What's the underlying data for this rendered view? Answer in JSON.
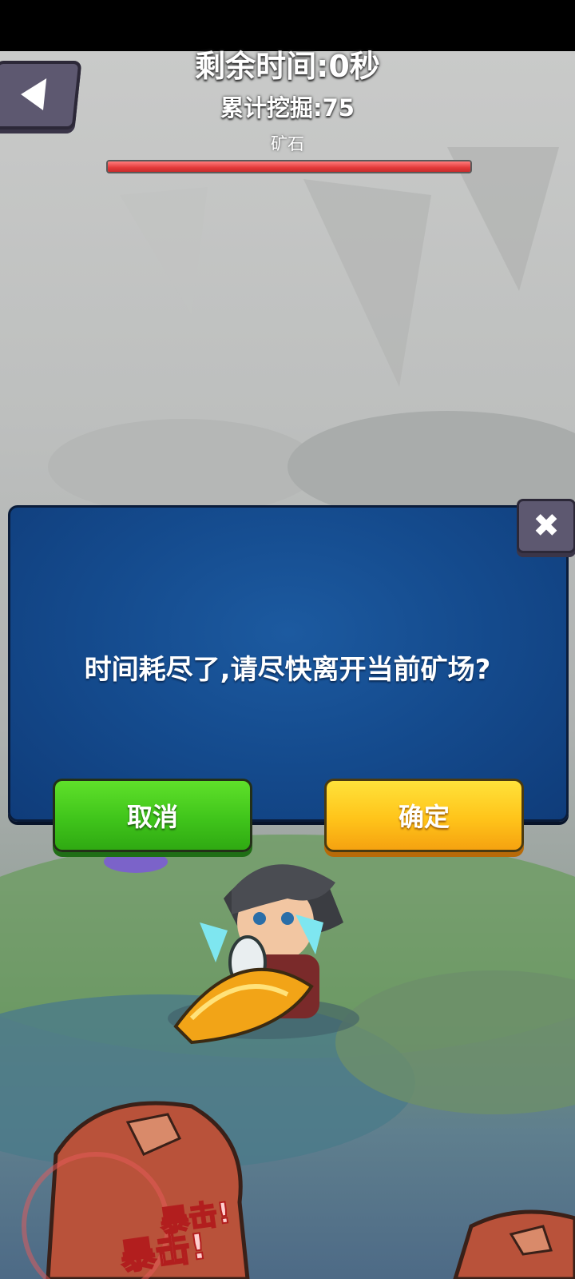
{
  "hud": {
    "timer_text": "剩余时间:0秒",
    "mined_text": "累计挖掘:75",
    "ore_label": "矿石",
    "ore_hp_fraction": 1.0
  },
  "dialog": {
    "message": "时间耗尽了,请尽快离开当前矿场?",
    "cancel_label": "取消",
    "confirm_label": "确定"
  },
  "icons": {
    "back": "back-arrow-icon",
    "close": "close-icon"
  },
  "effects": {
    "crit_text": "暴击!"
  },
  "colors": {
    "dialog_blue": "#154c8f",
    "cancel_green": "#40c51b",
    "confirm_yellow": "#ffc41a",
    "hp_red": "#e23a3a"
  }
}
